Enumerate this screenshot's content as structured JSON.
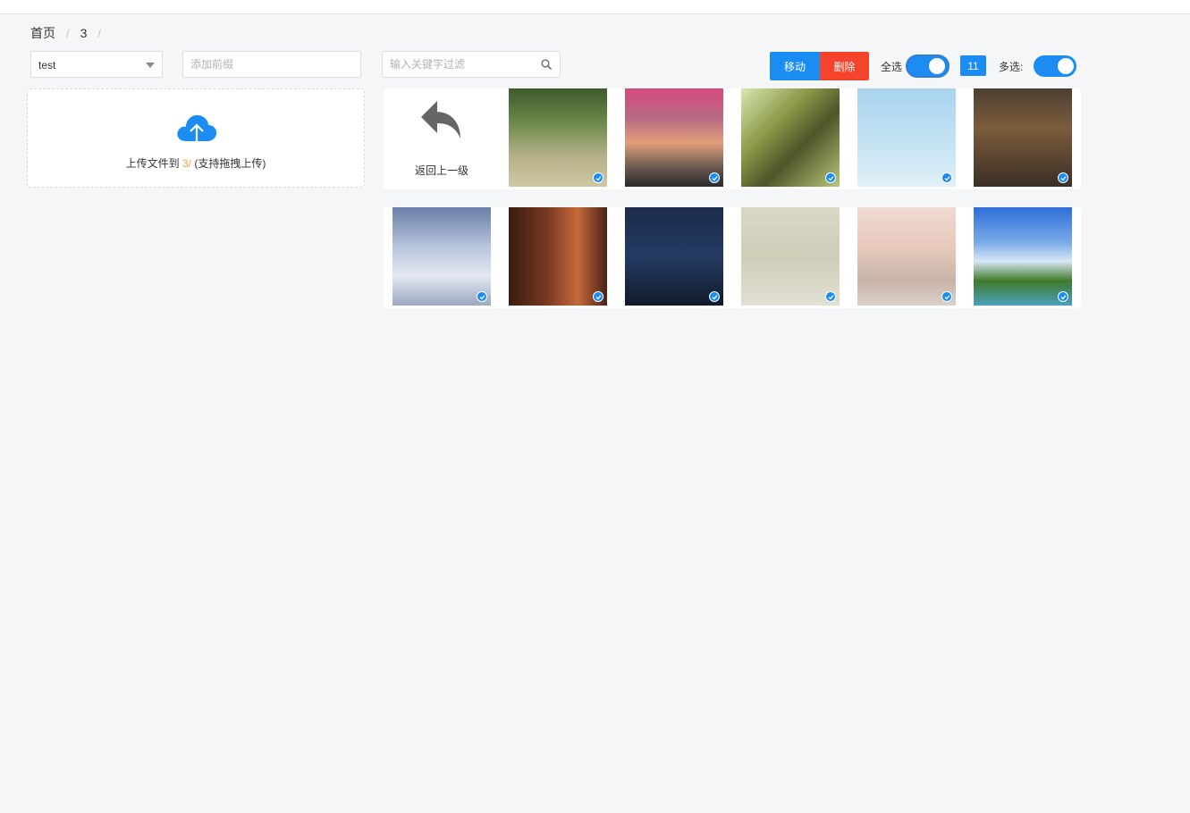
{
  "breadcrumb": {
    "home": "首页",
    "current": "3",
    "separator": "/"
  },
  "toolbar": {
    "bucket_select_value": "test",
    "prefix_placeholder": "添加前缀",
    "search_placeholder": "输入关键字过滤",
    "move_label": "移动",
    "delete_label": "删除",
    "select_all_label": "全选",
    "select_all_on": true,
    "selected_count": "11",
    "multi_select_label": "多选:",
    "multi_select_on": true
  },
  "upload": {
    "text_before": "上传文件到",
    "path": "3/",
    "text_after": "(支持拖拽上传)"
  },
  "back_card": {
    "label": "返回上一级"
  },
  "thumbnails": [
    {
      "name": "forest-path-runner",
      "checked": true
    },
    {
      "name": "pink-blossom-sunset",
      "checked": true
    },
    {
      "name": "tree-trunk-bokeh",
      "checked": true
    },
    {
      "name": "hot-air-balloons-sky",
      "checked": true
    },
    {
      "name": "fantasy-party-scene",
      "checked": true
    },
    {
      "name": "snowy-bench-scene",
      "checked": true
    },
    {
      "name": "vintage-camera",
      "checked": true
    },
    {
      "name": "night-city-moon",
      "checked": true
    },
    {
      "name": "misty-landscape-painting",
      "checked": true
    },
    {
      "name": "balcony-child-scene",
      "checked": true
    },
    {
      "name": "windmill-landscape",
      "checked": true
    }
  ],
  "colors": {
    "primary": "#1b8cf2",
    "danger": "#f5432c",
    "highlight": "#f0a23b"
  }
}
